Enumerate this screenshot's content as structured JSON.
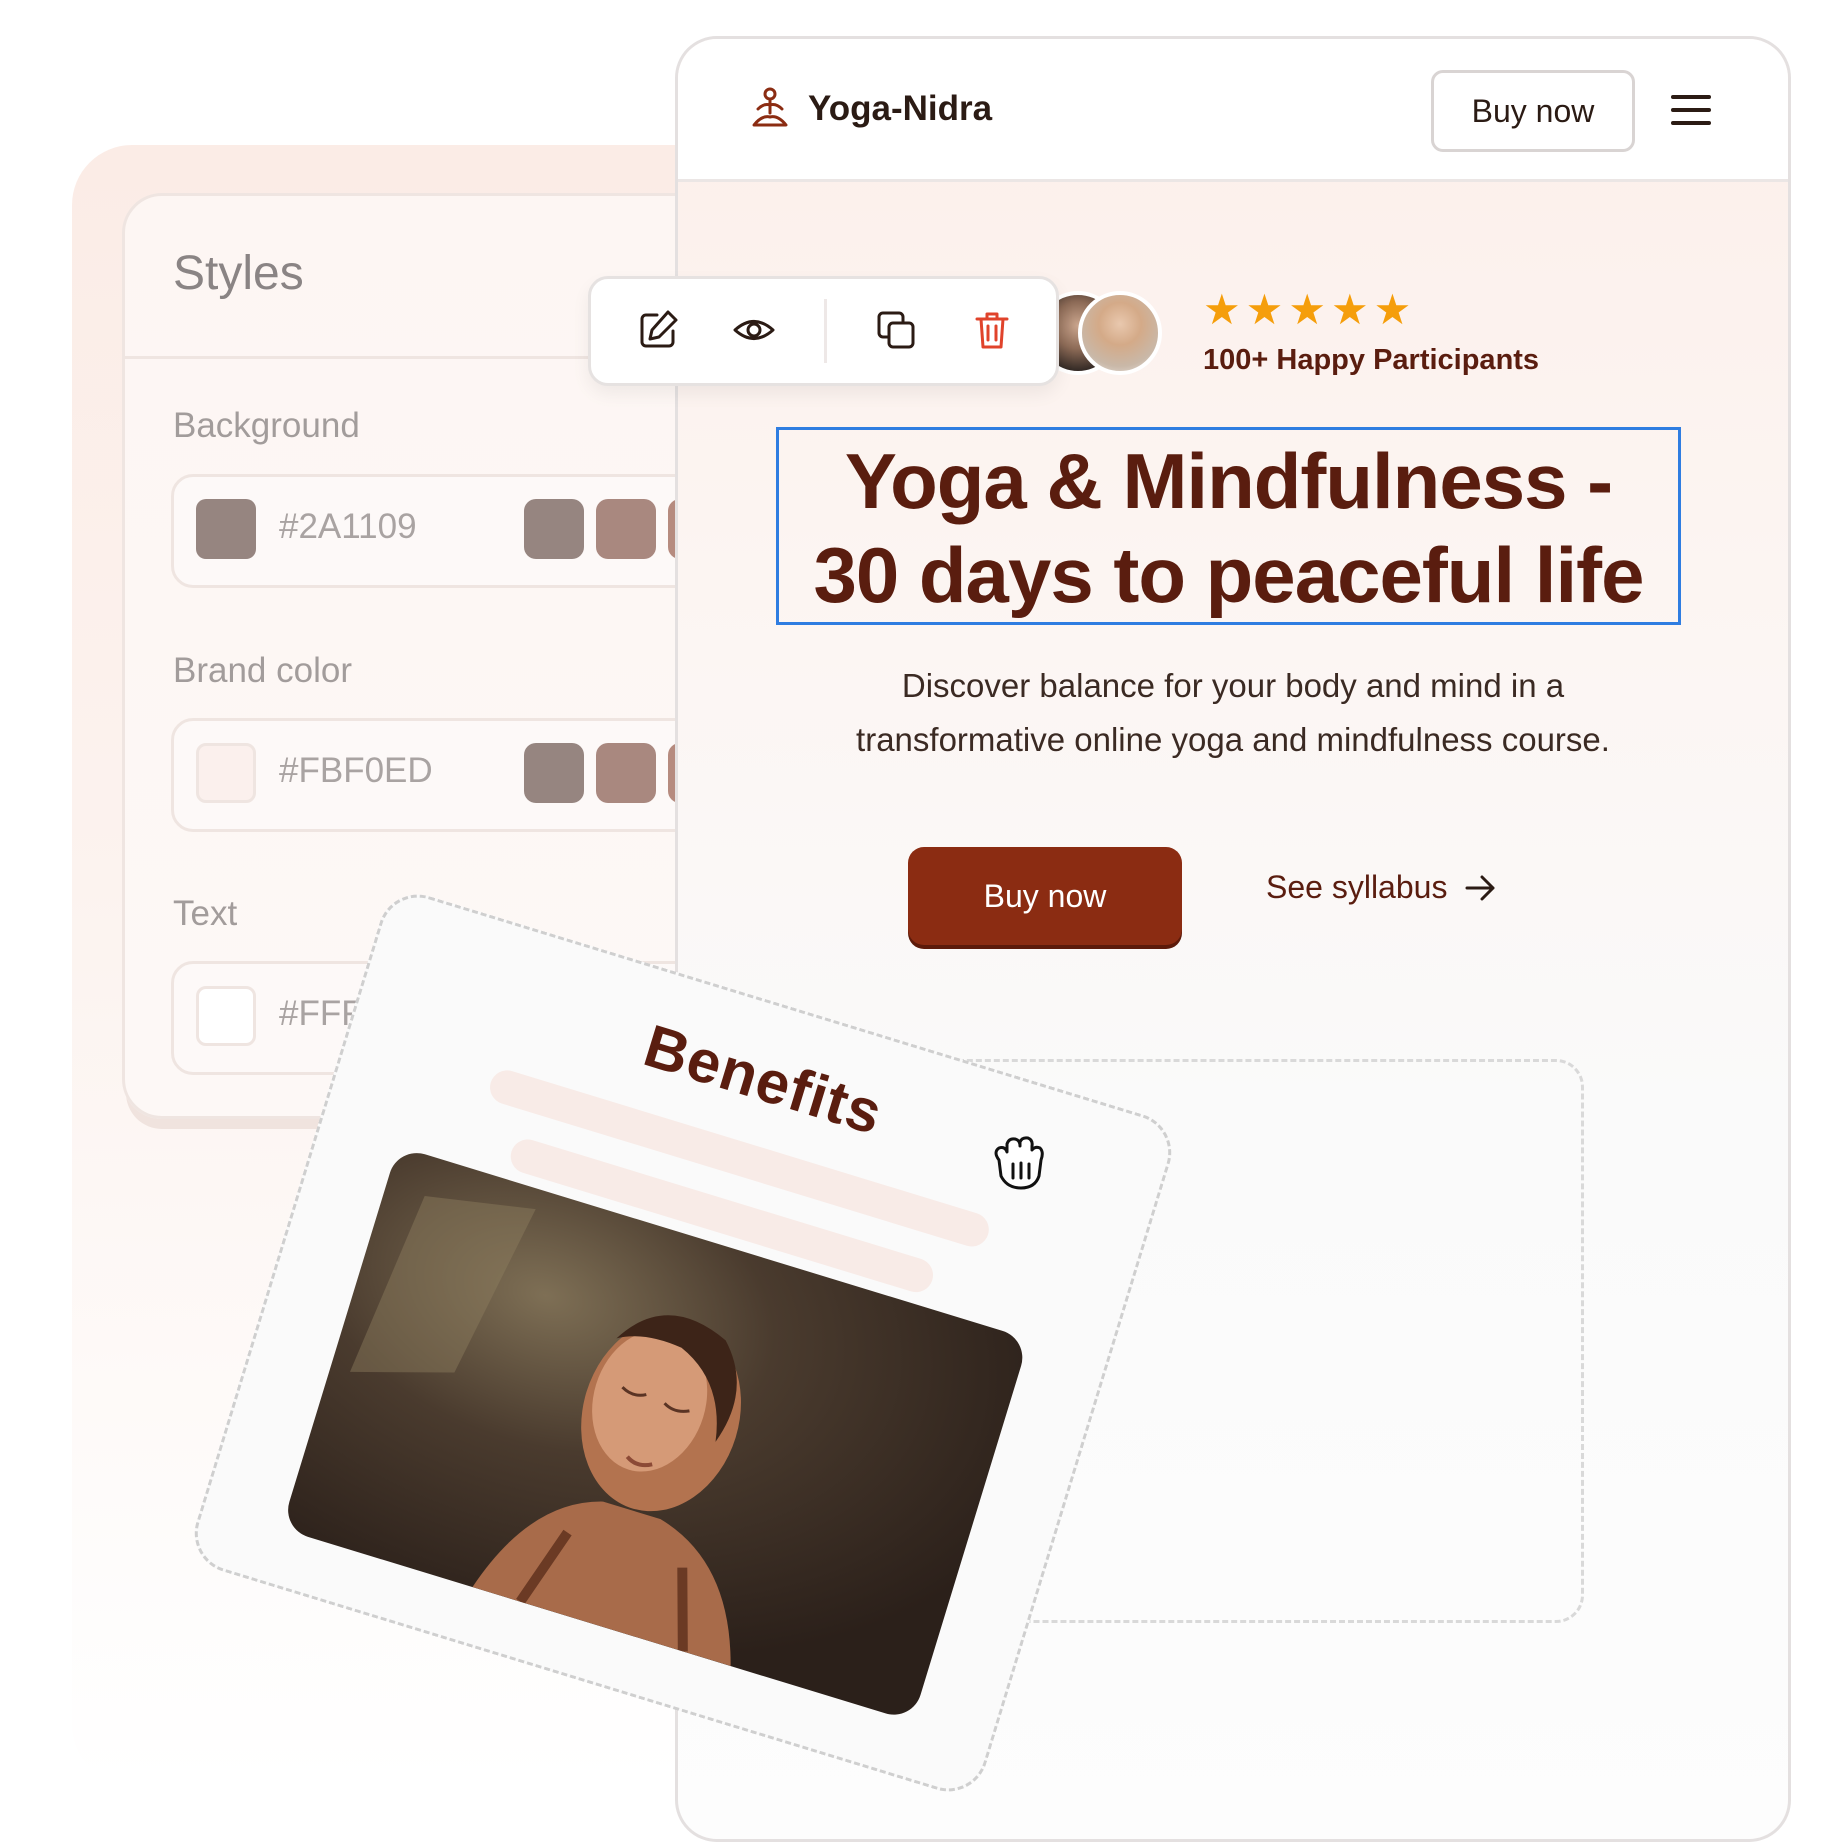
{
  "styles_panel": {
    "title": "Styles",
    "fields": [
      {
        "label": "Background",
        "value": "#2A1109",
        "swatch": "#968580",
        "presets": [
          "#968580",
          "#a9887f",
          "#b68b7f"
        ]
      },
      {
        "label": "Brand color",
        "value": "#FBF0ED",
        "swatch": "#fbf0ed",
        "presets": [
          "#968580",
          "#a9887f",
          "#b68b7f"
        ]
      },
      {
        "label": "Text",
        "value": "#FFFF",
        "swatch": "#ffffff",
        "presets": []
      }
    ]
  },
  "toolbar": {
    "buttons": [
      "edit-icon",
      "eye-icon",
      "duplicate-icon",
      "trash-icon"
    ],
    "trash_color": "#e0432b"
  },
  "site": {
    "brand": "Yoga-Nidra",
    "header_buy": "Buy now",
    "rating_stars": 5,
    "participants": "100+ Happy Participants",
    "headline_line1": "Yoga & Mindfulness -",
    "headline_line2": "30 days to peaceful life",
    "subtitle_line1": "Discover balance for your body and mind in a",
    "subtitle_line2": "transformative online yoga and mindfulness course.",
    "cta_primary": "Buy now",
    "cta_secondary": "See syllabus",
    "brand_color": "#8b2c12",
    "selection_color": "#2f7de1"
  },
  "benefits_card": {
    "title": "Benefits"
  }
}
